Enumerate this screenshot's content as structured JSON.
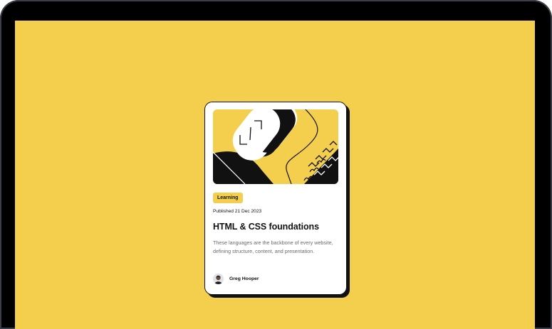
{
  "card": {
    "category": "Learning",
    "published": "Published 21 Dec 2023",
    "title": "HTML & CSS foundations",
    "description": "These languages are the backbone of every website, defining structure, content, and presentation.",
    "author": "Greg Hooper"
  },
  "colors": {
    "accent": "#f4cf4e",
    "ink": "#111111",
    "muted": "#6b6b6b",
    "surface": "#ffffff"
  },
  "icons": {
    "hero": "abstract-shapes-illustration",
    "avatar": "user-avatar"
  }
}
